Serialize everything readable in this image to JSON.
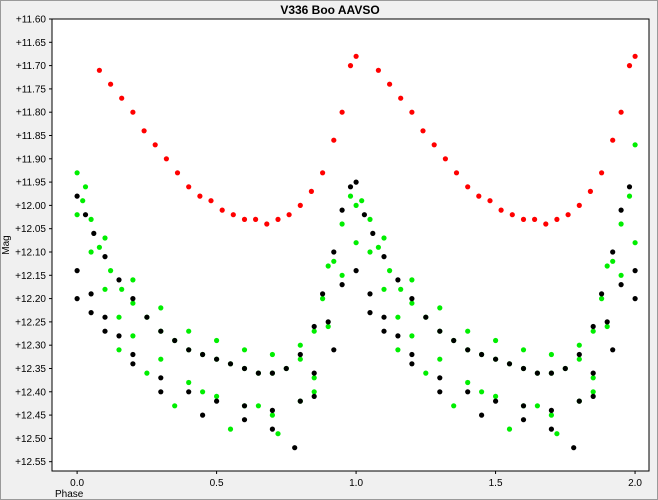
{
  "chart_data": {
    "type": "scatter",
    "title": "V336 Boo AAVSO",
    "xlabel": "Phase",
    "ylabel": "Mag",
    "xlim": [
      -0.09,
      2.05
    ],
    "ylim": [
      11.6,
      12.57
    ],
    "y_inverted": true,
    "grid": false,
    "x_ticks": [
      0.0,
      0.5,
      1.0,
      1.5,
      2.0
    ],
    "x_tick_labels": [
      "0.0",
      "0.5",
      "1.0",
      "1.5",
      "2.0"
    ],
    "y_ticks": [
      11.6,
      11.65,
      11.7,
      11.75,
      11.8,
      11.85,
      11.9,
      11.95,
      12.0,
      12.05,
      12.1,
      12.15,
      12.2,
      12.25,
      12.3,
      12.35,
      12.4,
      12.45,
      12.5,
      12.55
    ],
    "y_tick_labels": [
      "+11.60",
      "+11.65",
      "+11.70",
      "+11.75",
      "+11.80",
      "+11.85",
      "+11.90",
      "+11.95",
      "+12.00",
      "+12.05",
      "+12.10",
      "+12.15",
      "+12.20",
      "+12.25",
      "+12.30",
      "+12.35",
      "+12.40",
      "+12.45",
      "+12.50",
      "+12.55"
    ],
    "series": [
      {
        "color": "#ff0000",
        "points": [
          [
            0.08,
            11.71
          ],
          [
            0.12,
            11.74
          ],
          [
            0.16,
            11.77
          ],
          [
            0.2,
            11.8
          ],
          [
            0.24,
            11.84
          ],
          [
            0.28,
            11.87
          ],
          [
            0.32,
            11.9
          ],
          [
            0.36,
            11.93
          ],
          [
            0.4,
            11.96
          ],
          [
            0.44,
            11.98
          ],
          [
            0.48,
            11.99
          ],
          [
            0.52,
            12.01
          ],
          [
            0.56,
            12.02
          ],
          [
            0.6,
            12.03
          ],
          [
            0.64,
            12.03
          ],
          [
            0.68,
            12.04
          ],
          [
            0.72,
            12.03
          ],
          [
            0.76,
            12.02
          ],
          [
            0.8,
            12.0
          ],
          [
            0.84,
            11.97
          ],
          [
            0.88,
            11.93
          ],
          [
            0.92,
            11.86
          ],
          [
            0.95,
            11.8
          ],
          [
            0.98,
            11.7
          ],
          [
            1.0,
            11.68
          ],
          [
            1.08,
            11.71
          ],
          [
            1.12,
            11.74
          ],
          [
            1.16,
            11.77
          ],
          [
            1.2,
            11.8
          ],
          [
            1.24,
            11.84
          ],
          [
            1.28,
            11.87
          ],
          [
            1.32,
            11.9
          ],
          [
            1.36,
            11.93
          ],
          [
            1.4,
            11.96
          ],
          [
            1.44,
            11.98
          ],
          [
            1.48,
            11.99
          ],
          [
            1.52,
            12.01
          ],
          [
            1.56,
            12.02
          ],
          [
            1.6,
            12.03
          ],
          [
            1.64,
            12.03
          ],
          [
            1.68,
            12.04
          ],
          [
            1.72,
            12.03
          ],
          [
            1.76,
            12.02
          ],
          [
            1.8,
            12.0
          ],
          [
            1.84,
            11.97
          ],
          [
            1.88,
            11.93
          ],
          [
            1.92,
            11.86
          ],
          [
            1.95,
            11.8
          ],
          [
            1.98,
            11.7
          ],
          [
            2.0,
            11.68
          ]
        ]
      },
      {
        "color": "#00ee00",
        "points": [
          [
            0.0,
            11.93
          ],
          [
            0.02,
            11.99
          ],
          [
            0.05,
            12.03
          ],
          [
            0.08,
            12.09
          ],
          [
            0.12,
            12.14
          ],
          [
            0.16,
            12.18
          ],
          [
            0.2,
            12.21
          ],
          [
            0.25,
            12.24
          ],
          [
            0.3,
            12.27
          ],
          [
            0.35,
            12.29
          ],
          [
            0.4,
            12.31
          ],
          [
            0.45,
            12.32
          ],
          [
            0.5,
            12.33
          ],
          [
            0.55,
            12.34
          ],
          [
            0.6,
            12.35
          ],
          [
            0.65,
            12.36
          ],
          [
            0.7,
            12.36
          ],
          [
            0.75,
            12.35
          ],
          [
            0.8,
            12.33
          ],
          [
            0.85,
            12.27
          ],
          [
            0.88,
            12.2
          ],
          [
            0.92,
            12.12
          ],
          [
            0.95,
            12.04
          ],
          [
            0.98,
            11.98
          ],
          [
            0.0,
            12.02
          ],
          [
            0.05,
            12.1
          ],
          [
            0.1,
            12.18
          ],
          [
            0.15,
            12.24
          ],
          [
            0.2,
            12.28
          ],
          [
            0.3,
            12.33
          ],
          [
            0.4,
            12.38
          ],
          [
            0.5,
            12.41
          ],
          [
            0.6,
            12.43
          ],
          [
            0.7,
            12.45
          ],
          [
            0.8,
            12.42
          ],
          [
            0.85,
            12.37
          ],
          [
            0.9,
            12.26
          ],
          [
            0.95,
            12.15
          ],
          [
            1.0,
            12.08
          ],
          [
            0.03,
            11.96
          ],
          [
            0.1,
            12.07
          ],
          [
            0.2,
            12.16
          ],
          [
            0.3,
            12.22
          ],
          [
            0.4,
            12.27
          ],
          [
            0.5,
            12.29
          ],
          [
            0.6,
            12.31
          ],
          [
            0.7,
            12.32
          ],
          [
            0.8,
            12.3
          ],
          [
            0.9,
            12.13
          ],
          [
            0.15,
            12.31
          ],
          [
            0.35,
            12.43
          ],
          [
            0.55,
            12.48
          ],
          [
            0.65,
            12.43
          ],
          [
            0.72,
            12.49
          ],
          [
            0.25,
            12.36
          ],
          [
            0.45,
            12.4
          ],
          [
            0.85,
            12.4
          ],
          [
            1.0,
            12.0
          ],
          [
            1.02,
            11.99
          ],
          [
            1.05,
            12.03
          ],
          [
            1.08,
            12.09
          ],
          [
            1.12,
            12.14
          ],
          [
            1.16,
            12.18
          ],
          [
            1.2,
            12.21
          ],
          [
            1.25,
            12.24
          ],
          [
            1.3,
            12.27
          ],
          [
            1.35,
            12.29
          ],
          [
            1.4,
            12.31
          ],
          [
            1.45,
            12.32
          ],
          [
            1.5,
            12.33
          ],
          [
            1.55,
            12.34
          ],
          [
            1.6,
            12.35
          ],
          [
            1.65,
            12.36
          ],
          [
            1.7,
            12.36
          ],
          [
            1.75,
            12.35
          ],
          [
            1.8,
            12.33
          ],
          [
            1.85,
            12.27
          ],
          [
            1.88,
            12.2
          ],
          [
            1.92,
            12.12
          ],
          [
            1.95,
            12.04
          ],
          [
            1.98,
            11.98
          ],
          [
            1.05,
            12.1
          ],
          [
            1.1,
            12.18
          ],
          [
            1.15,
            12.24
          ],
          [
            1.2,
            12.28
          ],
          [
            1.3,
            12.33
          ],
          [
            1.4,
            12.38
          ],
          [
            1.5,
            12.41
          ],
          [
            1.6,
            12.43
          ],
          [
            1.7,
            12.45
          ],
          [
            1.8,
            12.42
          ],
          [
            1.85,
            12.37
          ],
          [
            1.9,
            12.26
          ],
          [
            1.95,
            12.15
          ],
          [
            2.0,
            12.08
          ],
          [
            1.1,
            12.07
          ],
          [
            1.2,
            12.16
          ],
          [
            1.3,
            12.22
          ],
          [
            1.4,
            12.27
          ],
          [
            1.5,
            12.29
          ],
          [
            1.6,
            12.31
          ],
          [
            1.7,
            12.32
          ],
          [
            1.8,
            12.3
          ],
          [
            1.9,
            12.13
          ],
          [
            1.15,
            12.31
          ],
          [
            1.35,
            12.43
          ],
          [
            1.55,
            12.48
          ],
          [
            1.65,
            12.43
          ],
          [
            1.72,
            12.49
          ],
          [
            1.25,
            12.36
          ],
          [
            1.45,
            12.4
          ],
          [
            1.85,
            12.4
          ],
          [
            2.0,
            11.87
          ]
        ]
      },
      {
        "color": "#000000",
        "points": [
          [
            0.0,
            11.98
          ],
          [
            0.03,
            12.02
          ],
          [
            0.06,
            12.06
          ],
          [
            0.1,
            12.11
          ],
          [
            0.15,
            12.16
          ],
          [
            0.2,
            12.2
          ],
          [
            0.25,
            12.24
          ],
          [
            0.3,
            12.27
          ],
          [
            0.35,
            12.29
          ],
          [
            0.4,
            12.31
          ],
          [
            0.45,
            12.32
          ],
          [
            0.5,
            12.33
          ],
          [
            0.55,
            12.34
          ],
          [
            0.6,
            12.35
          ],
          [
            0.65,
            12.36
          ],
          [
            0.7,
            12.36
          ],
          [
            0.75,
            12.35
          ],
          [
            0.8,
            12.32
          ],
          [
            0.85,
            12.26
          ],
          [
            0.88,
            12.19
          ],
          [
            0.92,
            12.1
          ],
          [
            0.95,
            12.01
          ],
          [
            0.98,
            11.96
          ],
          [
            0.0,
            12.14
          ],
          [
            0.05,
            12.19
          ],
          [
            0.1,
            12.24
          ],
          [
            0.15,
            12.28
          ],
          [
            0.2,
            12.32
          ],
          [
            0.3,
            12.37
          ],
          [
            0.4,
            12.4
          ],
          [
            0.5,
            12.42
          ],
          [
            0.6,
            12.43
          ],
          [
            0.7,
            12.44
          ],
          [
            0.8,
            12.42
          ],
          [
            0.85,
            12.36
          ],
          [
            0.9,
            12.25
          ],
          [
            0.95,
            12.17
          ],
          [
            1.0,
            12.14
          ],
          [
            0.0,
            12.2
          ],
          [
            0.05,
            12.23
          ],
          [
            0.1,
            12.27
          ],
          [
            0.2,
            12.34
          ],
          [
            0.3,
            12.4
          ],
          [
            0.45,
            12.45
          ],
          [
            0.6,
            12.46
          ],
          [
            0.7,
            12.48
          ],
          [
            0.78,
            12.52
          ],
          [
            0.85,
            12.41
          ],
          [
            0.92,
            12.31
          ],
          [
            1.0,
            11.95
          ],
          [
            1.03,
            12.02
          ],
          [
            1.06,
            12.06
          ],
          [
            1.1,
            12.11
          ],
          [
            1.15,
            12.16
          ],
          [
            1.2,
            12.2
          ],
          [
            1.25,
            12.24
          ],
          [
            1.3,
            12.27
          ],
          [
            1.35,
            12.29
          ],
          [
            1.4,
            12.31
          ],
          [
            1.45,
            12.32
          ],
          [
            1.5,
            12.33
          ],
          [
            1.55,
            12.34
          ],
          [
            1.6,
            12.35
          ],
          [
            1.65,
            12.36
          ],
          [
            1.7,
            12.36
          ],
          [
            1.75,
            12.35
          ],
          [
            1.8,
            12.32
          ],
          [
            1.85,
            12.26
          ],
          [
            1.88,
            12.19
          ],
          [
            1.92,
            12.1
          ],
          [
            1.95,
            12.01
          ],
          [
            1.98,
            11.96
          ],
          [
            1.05,
            12.19
          ],
          [
            1.1,
            12.24
          ],
          [
            1.15,
            12.28
          ],
          [
            1.2,
            12.32
          ],
          [
            1.3,
            12.37
          ],
          [
            1.4,
            12.4
          ],
          [
            1.5,
            12.42
          ],
          [
            1.6,
            12.43
          ],
          [
            1.7,
            12.44
          ],
          [
            1.8,
            12.42
          ],
          [
            1.85,
            12.36
          ],
          [
            1.9,
            12.25
          ],
          [
            1.95,
            12.17
          ],
          [
            2.0,
            12.14
          ],
          [
            1.05,
            12.23
          ],
          [
            1.1,
            12.27
          ],
          [
            1.2,
            12.34
          ],
          [
            1.3,
            12.4
          ],
          [
            1.45,
            12.45
          ],
          [
            1.6,
            12.46
          ],
          [
            1.7,
            12.48
          ],
          [
            1.78,
            12.52
          ],
          [
            1.85,
            12.41
          ],
          [
            1.92,
            12.31
          ],
          [
            2.0,
            12.2
          ]
        ]
      }
    ]
  }
}
